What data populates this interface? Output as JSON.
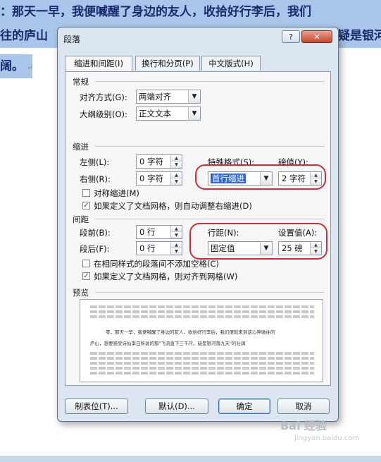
{
  "document": {
    "line1": "：那天一早，我便喊醒了身边的友人，收拾好行李后，我们",
    "line2_a": "往的庐山",
    "line2_b": "疑是银河",
    "line3": "阔。",
    "para_mark": "↵"
  },
  "dialog": {
    "title": "段落",
    "help": "?",
    "close": "✕",
    "tabs": [
      "缩进和间距(I)",
      "换行和分页(P)",
      "中文版式(H)"
    ],
    "general": {
      "title": "常规",
      "alignment_label": "对齐方式(G):",
      "alignment_value": "两端对齐",
      "outline_label": "大纲级别(O):",
      "outline_value": "正文文本"
    },
    "indent": {
      "title": "缩进",
      "left_label": "左侧(L):",
      "left_value": "0 字符",
      "right_label": "右侧(R):",
      "right_value": "0 字符",
      "special_label": "特殊格式(S):",
      "special_value": "首行缩进",
      "by_label": "磅值(Y):",
      "by_value": "2 字符",
      "mirror_label": "对称缩进(M)",
      "mirror_checked": false,
      "auto_adjust_label": "如果定义了文档网格，则自动调整右缩进(D)",
      "auto_adjust_checked": true
    },
    "spacing": {
      "title": "间距",
      "before_label": "段前(B):",
      "before_value": "0 行",
      "after_label": "段后(F):",
      "after_value": "0 行",
      "line_spacing_label": "行距(N):",
      "line_spacing_value": "固定值",
      "at_label": "设置值(A):",
      "at_value": "25 磅",
      "no_space_label": "在相同样式的段落间不添加空格(C)",
      "no_space_checked": false,
      "snap_grid_label": "如果定义了文档网格，则对齐到网格(W)",
      "snap_grid_checked": true
    },
    "preview": {
      "title": "预览",
      "text1": "零，那天一早，我便喊醒了身边的友人，收拾好行李后，我们便就来到这心神驰往的",
      "text2": "庐山，想要感受诗仙李白所说的那\"飞流直下三千尺，疑是银河落九天\"的壮阔"
    },
    "buttons": {
      "tabs": "制表位(T)...",
      "default": "默认(D)...",
      "ok": "确定",
      "cancel": "取消"
    }
  },
  "watermark": {
    "brand": "Bai 经验",
    "url": "jingyan.baidu.com"
  },
  "colors": {
    "highlight": "#a9c6ea",
    "annotation_ring": "#c3313b",
    "selection": "#3567c7"
  }
}
